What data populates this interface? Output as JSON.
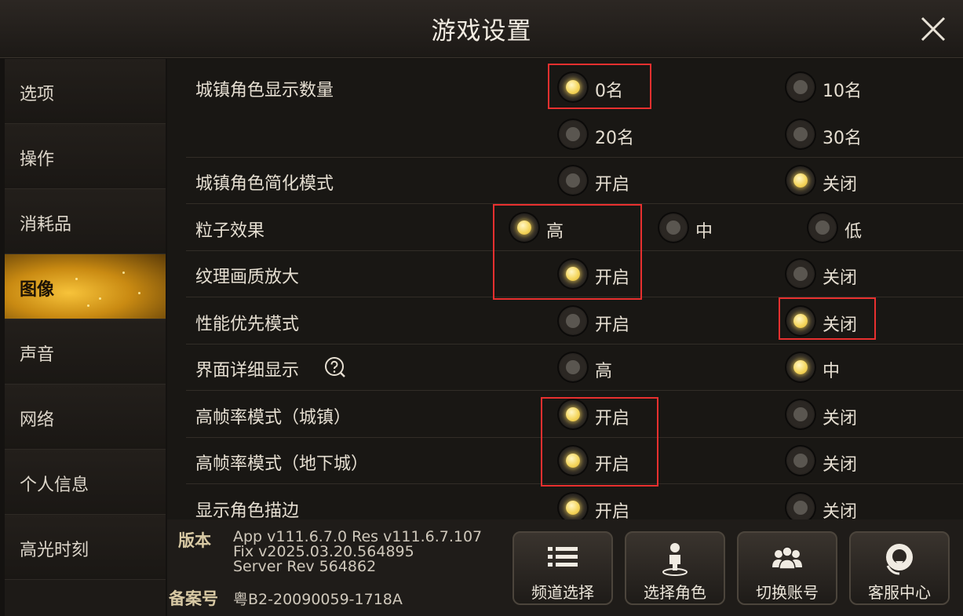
{
  "window": {
    "title": "游戏设置"
  },
  "sidebar": {
    "items": [
      {
        "label": "选项"
      },
      {
        "label": "操作"
      },
      {
        "label": "消耗品"
      },
      {
        "label": "图像",
        "active": true
      },
      {
        "label": "声音"
      },
      {
        "label": "网络"
      },
      {
        "label": "个人信息"
      },
      {
        "label": "高光时刻"
      }
    ]
  },
  "settings": {
    "town_count": {
      "label": "城镇角色显示数量",
      "options": [
        "0名",
        "10名",
        "20名",
        "30名"
      ],
      "selected": "0名"
    },
    "town_simplified": {
      "label": "城镇角色简化模式",
      "options": [
        "开启",
        "关闭"
      ],
      "selected": "关闭"
    },
    "particle": {
      "label": "粒子效果",
      "options": [
        "高",
        "中",
        "低"
      ],
      "selected": "高"
    },
    "texture": {
      "label": "纹理画质放大",
      "options": [
        "开启",
        "关闭"
      ],
      "selected": "开启"
    },
    "performance": {
      "label": "性能优先模式",
      "options": [
        "开启",
        "关闭"
      ],
      "selected": "关闭"
    },
    "ui_detail": {
      "label": "界面详细显示",
      "options": [
        "高",
        "中"
      ],
      "selected": "中"
    },
    "hfr_town": {
      "label": "高帧率模式（城镇）",
      "options": [
        "开启",
        "关闭"
      ],
      "selected": "开启"
    },
    "hfr_dungeon": {
      "label": "高帧率模式（地下城）",
      "options": [
        "开启",
        "关闭"
      ],
      "selected": "开启"
    },
    "outline": {
      "label": "显示角色描边",
      "options": [
        "开启",
        "关闭"
      ],
      "selected": "开启"
    }
  },
  "footer": {
    "version_label": "版本",
    "version_lines": [
      "App v111.6.7.0 Res v111.6.7.107",
      "Fix v2025.03.20.564895",
      "Server Rev 564862"
    ],
    "record_label": "备案号",
    "record_value": "粤B2-20090059-1718A",
    "buttons": [
      {
        "label": "频道选择",
        "icon": "list-icon"
      },
      {
        "label": "选择角色",
        "icon": "character-pin-icon"
      },
      {
        "label": "切换账号",
        "icon": "users-icon"
      },
      {
        "label": "客服中心",
        "icon": "support-icon"
      }
    ]
  },
  "colors": {
    "accent": "#f5d760",
    "highlight_box": "#e8302f",
    "active_tab": "#e0a01c"
  }
}
